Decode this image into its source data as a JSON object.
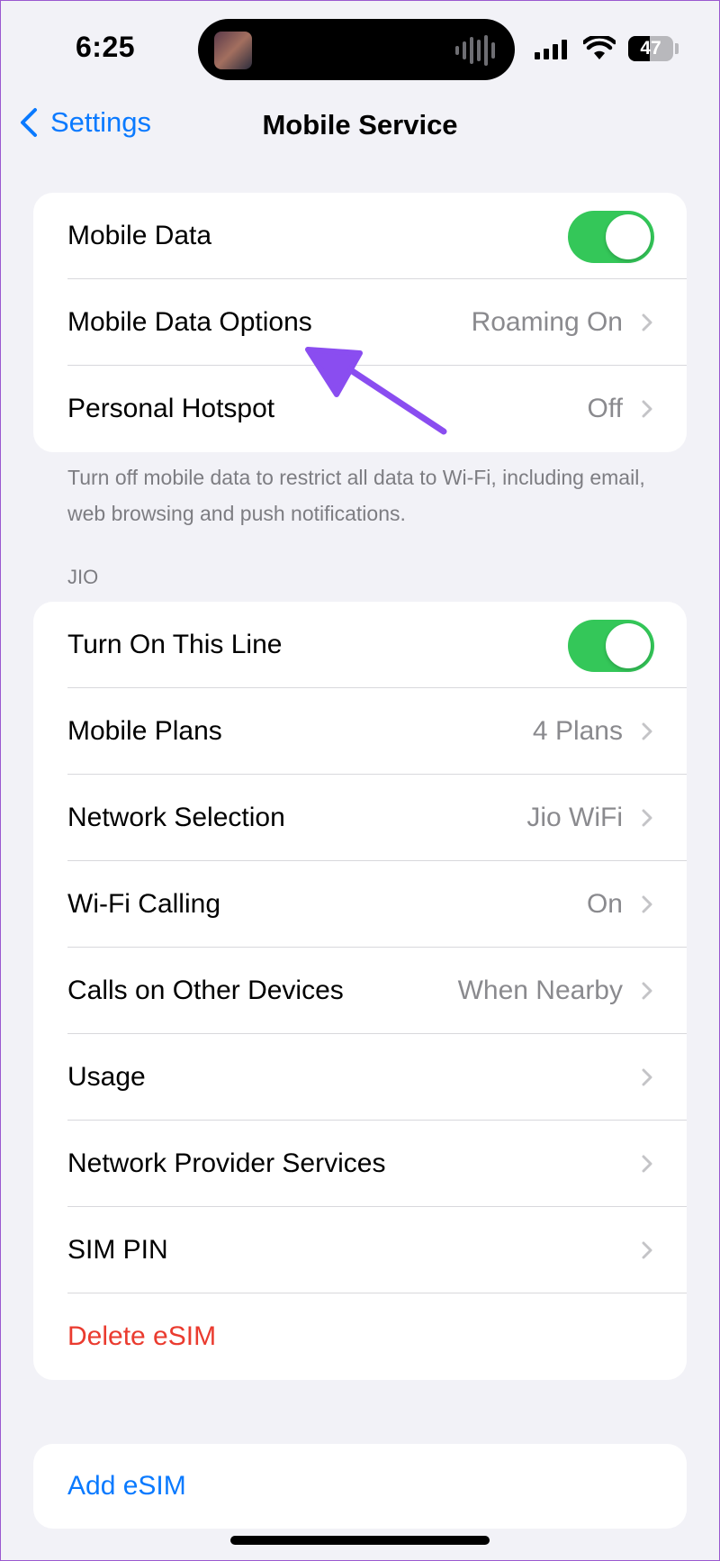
{
  "status": {
    "time": "6:25",
    "battery": "47",
    "battery_level": 0.47
  },
  "nav": {
    "back_label": "Settings",
    "title": "Mobile Service"
  },
  "group1": {
    "rows": [
      {
        "label": "Mobile Data",
        "toggle": true
      },
      {
        "label": "Mobile Data Options",
        "value": "Roaming On"
      },
      {
        "label": "Personal Hotspot",
        "value": "Off"
      }
    ],
    "footer": "Turn off mobile data to restrict all data to Wi-Fi, including email, web browsing and push notifications."
  },
  "group2": {
    "header": "JIO",
    "rows": [
      {
        "label": "Turn On This Line",
        "toggle": true
      },
      {
        "label": "Mobile Plans",
        "value": "4 Plans"
      },
      {
        "label": "Network Selection",
        "value": "Jio WiFi"
      },
      {
        "label": "Wi-Fi Calling",
        "value": "On"
      },
      {
        "label": "Calls on Other Devices",
        "value": "When Nearby"
      },
      {
        "label": "Usage",
        "value": ""
      },
      {
        "label": "Network Provider Services",
        "value": ""
      },
      {
        "label": "SIM PIN",
        "value": ""
      },
      {
        "label": "Delete eSIM"
      }
    ]
  },
  "group3": {
    "add_esim": "Add eSIM"
  },
  "colors": {
    "accent": "#0a7aff",
    "toggle_on": "#34c759",
    "destructive": "#ea3b2f",
    "annotation_arrow": "#8a4df0"
  },
  "icons": [
    "chevron-left-icon",
    "chevron-right-icon",
    "cellular-signal-icon",
    "wifi-icon",
    "battery-icon",
    "arrow-annotation-icon"
  ]
}
